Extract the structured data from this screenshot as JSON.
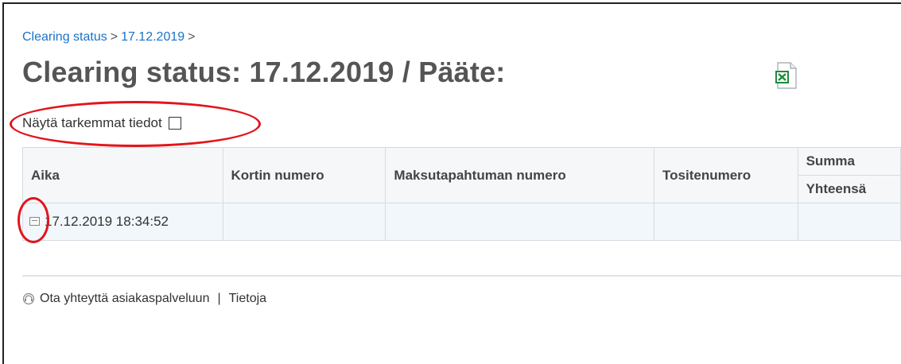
{
  "breadcrumb": {
    "items": [
      "Clearing status",
      "17.12.2019"
    ],
    "separator": ">"
  },
  "page_title": "Clearing status: 17.12.2019 / Pääte:",
  "export_icon": "excel-export-icon",
  "details_toggle": {
    "label": "Näytä tarkemmat tiedot",
    "checked": false
  },
  "table": {
    "headers": {
      "aika": "Aika",
      "kortti": "Kortin numero",
      "maksu": "Maksutapahtuman numero",
      "tosite": "Tositenumero",
      "summa": "Summa",
      "summa_sub": "Yhteensä"
    },
    "rows": [
      {
        "aika": "17.12.2019 18:34:52",
        "kortti": "",
        "maksu": "",
        "tosite": "",
        "summa": ""
      }
    ]
  },
  "footer": {
    "contact_label": "Ota yhteyttä asiakaspalveluun",
    "separator": "|",
    "info_label": "Tietoja"
  },
  "colors": {
    "link": "#1a73c8",
    "title": "#555555",
    "annotation": "#e3141b",
    "row_bg": "#f2f7fb"
  }
}
